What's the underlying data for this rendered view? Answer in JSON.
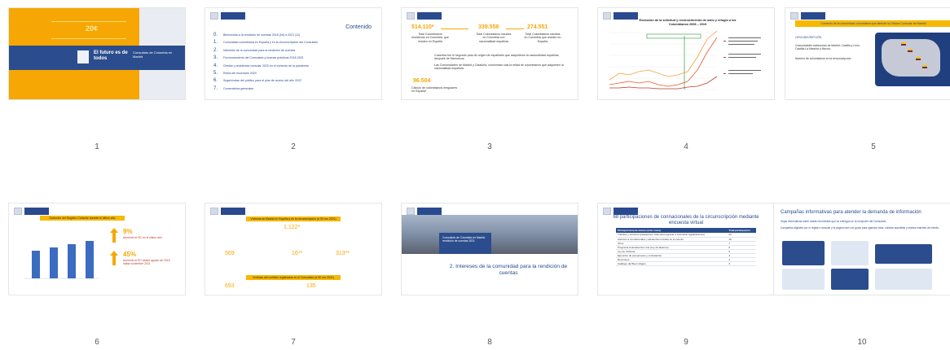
{
  "slides": [
    {
      "number": "1",
      "year": "20¢",
      "tagline": "El futuro es de todos",
      "office": "Consulado de Colombia en Madrid"
    },
    {
      "number": "2",
      "title": "Contenido",
      "items": [
        {
          "n": "0.",
          "t": "Bienvenida a la rendición de cuentas 2018 (09) a 2021 (11)"
        },
        {
          "n": "1.",
          "t": "Comunidad colombiana en España y en la circunscripción del Consulado"
        },
        {
          "n": "2.",
          "t": "Intereses de la comunidad para la rendición de cuentas"
        },
        {
          "n": "3.",
          "t": "Funcionamiento del Consulado y buenas prácticas 2018-2021"
        },
        {
          "n": "4.",
          "t": "Gestión y asistencia consular 2020 en el contexto de la pandemia"
        },
        {
          "n": "5.",
          "t": "Retos del escenario 2020"
        },
        {
          "n": "6.",
          "t": "Sugerencias del público para el plan de acción del año 2022"
        },
        {
          "n": "7.",
          "t": "Comentarios generales"
        }
      ]
    },
    {
      "number": "3",
      "stats": [
        {
          "value": "514.110*",
          "caption": "Total Colombianos residiendo en Colombia, que residen en España"
        },
        {
          "value": "339.558",
          "caption": "Total Colombianos nacidos en Colombia con nacionalidad española"
        },
        {
          "value": "274.551",
          "caption": "Total Colombianos nacidos en Colombia que residen en España"
        }
      ],
      "notes": [
        "Colombia fue el segundo país de origen de españoles que adquirieron la nacionalidad española, después de Marruecos.",
        "Las Comunidades de Madrid y Cataluña, concentran casi la mitad de colombianos que adquieren la nacionalidad española."
      ],
      "extra_value": "96.504",
      "extra_caption": "Cálculo de colombianos irregulares en España*"
    },
    {
      "number": "4",
      "title": "Evolución de la solicitud y reconocimiento de asilo y refugio a los Colombianos 2008 – 2019"
    },
    {
      "number": "5",
      "title": "Contexto de la comunidad colombiana que atiende la Oficina Consular de Madrid",
      "text1": "CIRCUNSCRIPCIÓN",
      "text2": "Comunidades autónomas de Madrid, Castilla y León, Castilla-La Mancha y Murcia.",
      "text3": "Número de colombianos en la circunscripción."
    },
    {
      "number": "6",
      "title": "Evolución del Registro Consular durante el último año",
      "pct1": "9%",
      "cap1": "Aumentó el RC en el último año",
      "pct2": "45%",
      "cap2": "Aumentó el RC desde agosto de 2018 hasta noviembre 2021"
    },
    {
      "number": "7",
      "title1": "Víctimas de Madrid en España y en la circunscripción (a 30 nov 2021)",
      "v1": "1.122*",
      "v2": "569",
      "v3": "16**",
      "v4": "313**",
      "title2": "Víctimas del conflicto registradas en el Consulado (a 30 nov 2021)",
      "v5": "693",
      "v6": "135"
    },
    {
      "number": "8",
      "box": "Consulado de Colombia en Madrid rendición de cuentas 2021",
      "section": "2. Intereses de la comunidad para la rendición de cuentas"
    },
    {
      "number": "9",
      "title": "68 participaciones de connacionales de la circunscripción mediante encuesta virtual",
      "headers": [
        "Principal tema de interés (más votos)",
        "Total participación"
      ],
      "rows": [
        [
          "Trámites y servicios (pasaportes, citas para ingresar a Colombia, legalizaciones)",
          "24"
        ],
        [
          "Atención a connacionales y asistencia consular en el exterior",
          "16"
        ],
        [
          "Otros",
          "7"
        ],
        [
          "Programa Colombia Nos Une (Ley de Retorno)",
          "6"
        ],
        [
          "Ley de Víctimas",
          "5"
        ],
        [
          "Ejecución de presupuesto y contratación",
          "4"
        ],
        [
          "Reuniones",
          "3"
        ],
        [
          "Catálogo del Buen Viajero",
          "3"
        ]
      ]
    },
    {
      "number": "10",
      "title": "Campañas informativas para atender la demanda de información",
      "b1": "Hojas informativas sobre dudas recurrentes que se entregan en la recepción del Consulado.",
      "b2": "Campañas digitales por el registro consular y la página web con guías para agendar citas, solicitar apostillas y realizar trámites de interés."
    }
  ]
}
